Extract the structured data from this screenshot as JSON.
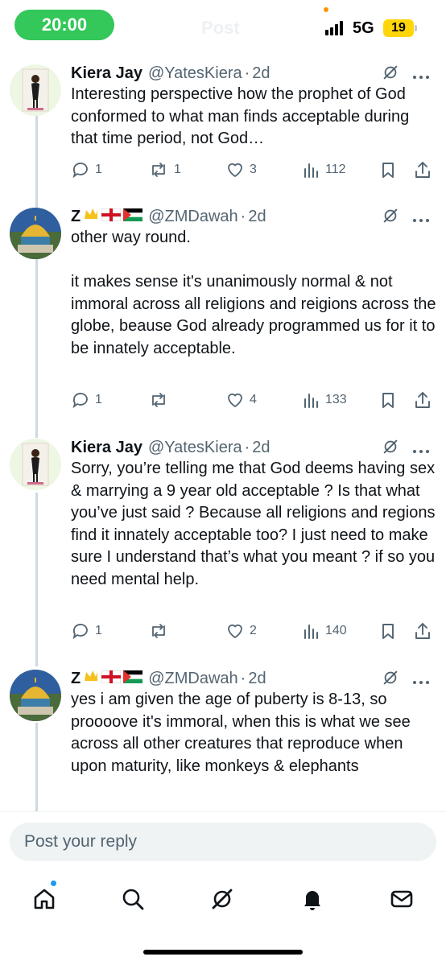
{
  "status_bar": {
    "time": "20:00",
    "network": "5G",
    "battery": "19",
    "ghost_title": "Post",
    "ghost_back": "←"
  },
  "tweets": [
    {
      "name": "Kiera Jay",
      "handle": "@YatesKiera",
      "date": "2d",
      "text": "Interesting perspective how the prophet of God conformed to what man finds acceptable during that time period, not God…",
      "replies": "1",
      "reposts": "1",
      "likes": "3",
      "views": "112"
    },
    {
      "name": "Z",
      "handle": "@ZMDawah",
      "date": "2d",
      "text": "other way round.\n\nit makes sense it's unanimously normal & not immoral across all religions and reigions across the globe, beause God already programmed us for it to be innately acceptable.",
      "replies": "1",
      "reposts": "",
      "likes": "4",
      "views": "133"
    },
    {
      "name": "Kiera Jay",
      "handle": "@YatesKiera",
      "date": "2d",
      "text": "Sorry, you’re telling me that God deems having sex & marrying a 9 year old acceptable ? Is that what you’ve just said ? Because all religions and regions find it innately acceptable too? I just need to make sure I understand that’s what you meant ? if so you need mental help.",
      "replies": "1",
      "reposts": "",
      "likes": "2",
      "views": "140"
    },
    {
      "name": "Z",
      "handle": "@ZMDawah",
      "date": "2d",
      "text": "yes i am given the age of puberty is 8-13, so proooove it's immoral, when this is what we see across all other creatures that reproduce when upon maturity, like monkeys & elephants"
    }
  ],
  "reply_box": {
    "placeholder": "Post your reply"
  },
  "tabs": [
    "home-icon",
    "search-icon",
    "grok-icon",
    "notifications-icon",
    "messages-icon"
  ],
  "colors": {
    "accent": "#1d9bf0",
    "time_pill": "#34c759",
    "battery": "#ffd60a",
    "muted_text": "#536471"
  }
}
